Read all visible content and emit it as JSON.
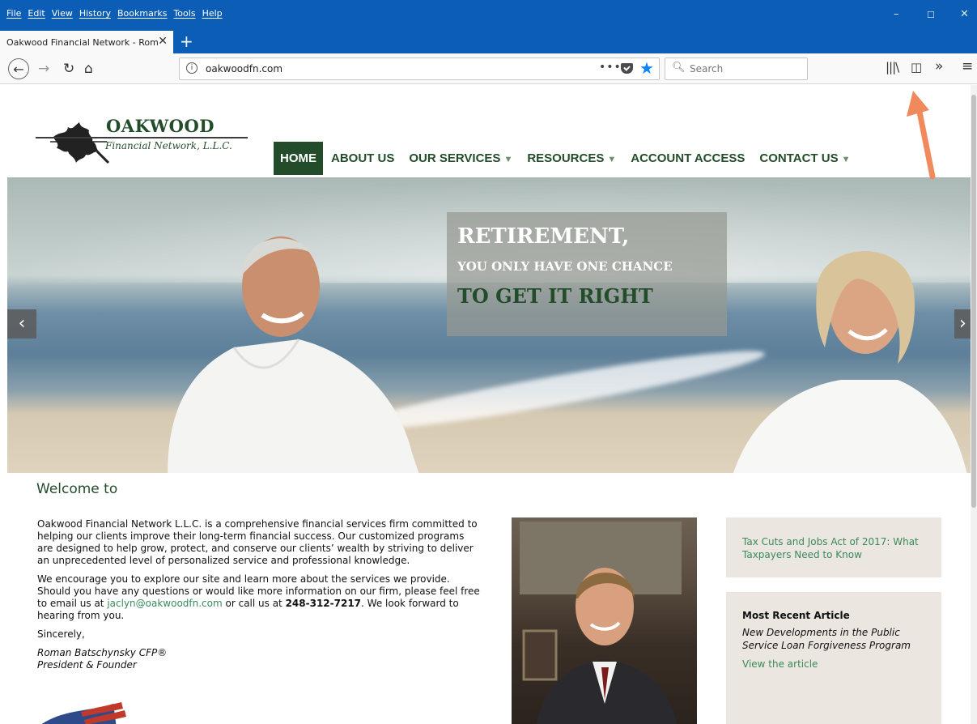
{
  "browser": {
    "menu": [
      "File",
      "Edit",
      "View",
      "History",
      "Bookmarks",
      "Tools",
      "Help"
    ],
    "tab_title": "Oakwood Financial Network - Rom",
    "url": "oakwoodfn.com",
    "search_placeholder": "Search",
    "window_controls": {
      "minimize": "–",
      "maximize": "☐",
      "close": "✕"
    }
  },
  "site": {
    "logo": {
      "name": "OAKWOOD",
      "subtitle": "Financial Network, L.L.C."
    },
    "nav": [
      {
        "label": "HOME",
        "active": true,
        "dropdown": false
      },
      {
        "label": "ABOUT US",
        "dropdown": false
      },
      {
        "label": "OUR SERVICES",
        "dropdown": true
      },
      {
        "label": "RESOURCES",
        "dropdown": true
      },
      {
        "label": "ACCOUNT ACCESS",
        "dropdown": false
      },
      {
        "label": "CONTACT US",
        "dropdown": true
      }
    ],
    "hero": {
      "line1": "RETIREMENT,",
      "line2": "YOU ONLY HAVE ONE CHANCE",
      "line3": "TO GET IT RIGHT"
    },
    "welcome": "Welcome to",
    "intro": {
      "p1": "Oakwood Financial Network L.L.C. is a comprehensive financial services firm committed to helping our clients improve their long-term financial success. Our customized programs are designed to help grow, protect, and conserve our clients’ wealth by striving to deliver an unprecedented level of personalized service and professional knowledge.",
      "p2_before": "We encourage you to explore our site and learn more about the services we provide. Should you have any questions or would like more information on our firm, please feel free to email us at ",
      "email": "jaclyn@oakwoodfn.com",
      "p2_mid": " or call us at ",
      "phone": "248-312-7217",
      "p2_after": ". We look forward to hearing from you.",
      "closing": "Sincerely,",
      "sig_name": "Roman Batschynsky CFP®",
      "sig_title": "President & Founder"
    },
    "sidebar": {
      "article_link": "Tax Cuts and Jobs Act of 2017: What Taxpayers Need to Know",
      "recent_heading": "Most Recent Article",
      "recent_title": "New Developments in the Public Service Loan Forgiveness Program",
      "view_link": "View the article"
    }
  }
}
